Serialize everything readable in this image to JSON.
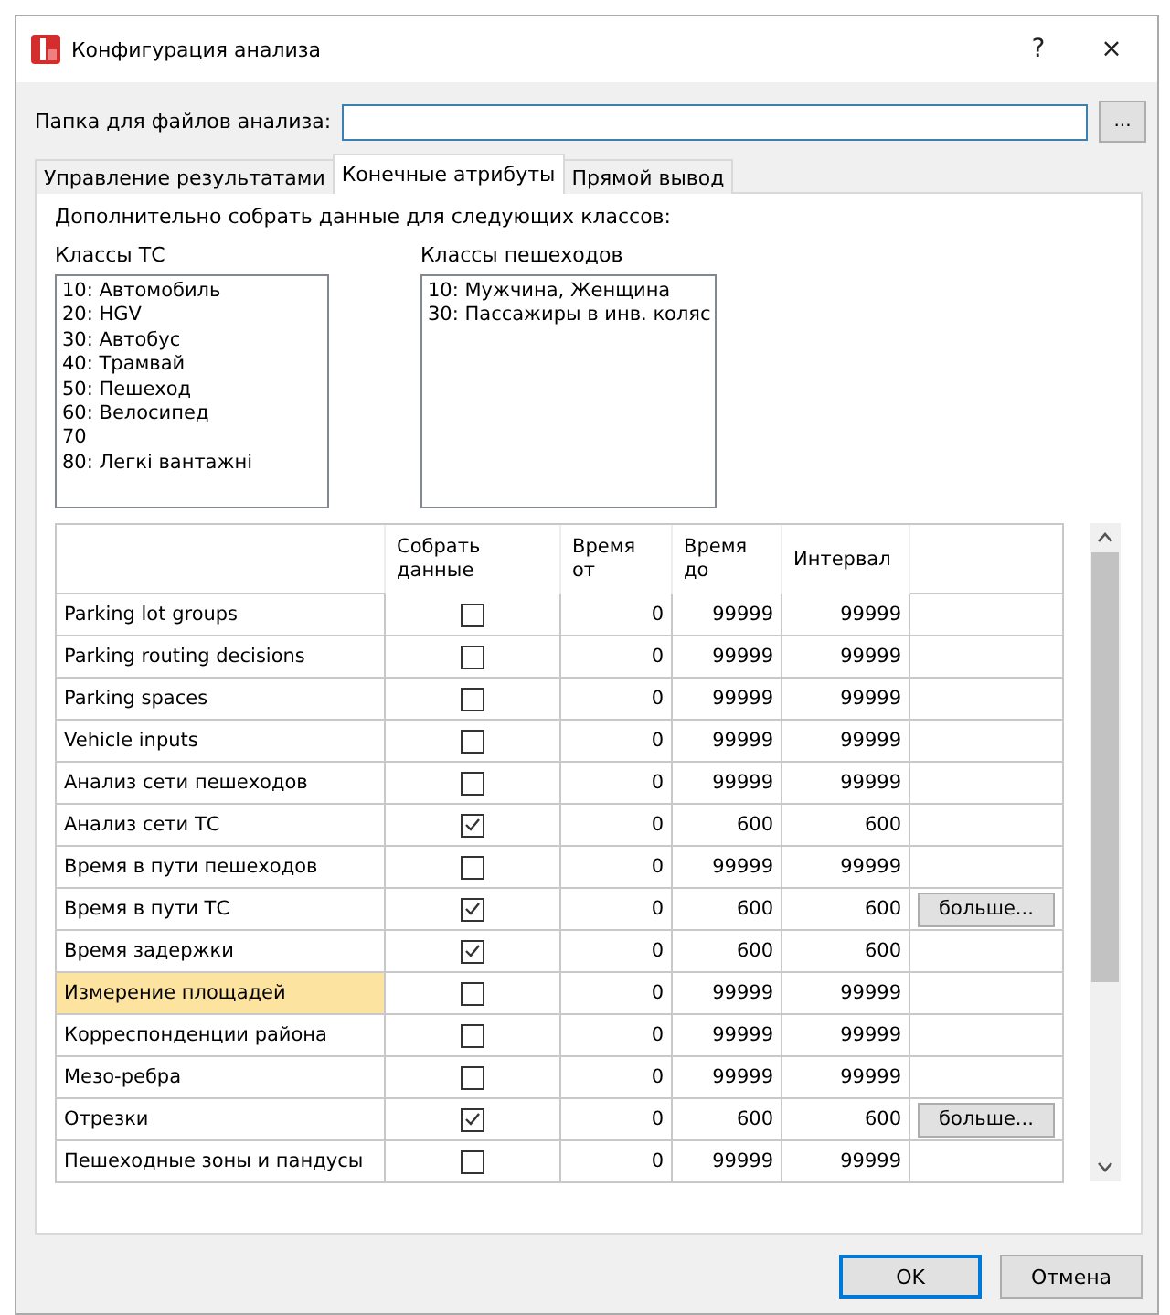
{
  "window": {
    "title": "Конфигурация анализа",
    "help": "?",
    "close": "×"
  },
  "folder": {
    "label": "Папка для файлов анализа:",
    "browse": "..."
  },
  "tabs": [
    {
      "label": "Управление результатами",
      "selected": false
    },
    {
      "label": "Конечные атрибуты",
      "selected": true
    },
    {
      "label": "Прямой вывод",
      "selected": false
    }
  ],
  "intro": "Дополнительно собрать данные для следующих классов:",
  "vehicle_classes": {
    "label": "Классы ТС",
    "items": [
      "10: Автомобиль",
      "20: HGV",
      "30: Автобус",
      "40: Трамвай",
      "50: Пешеход",
      "60: Велосипед",
      "70",
      "80: Легкі вантажні"
    ]
  },
  "pedestrian_classes": {
    "label": "Классы пешеходов",
    "items": [
      "10: Мужчина, Женщина",
      "30: Пассажиры в инв. коляс"
    ]
  },
  "table": {
    "columns": [
      "Собрать данные",
      "Время от",
      "Время до",
      "Интервал"
    ],
    "rows": [
      {
        "name": "Parking lot groups",
        "checked": false,
        "from": "0",
        "to": "99999",
        "interval": "99999",
        "selected": false
      },
      {
        "name": "Parking routing decisions",
        "checked": false,
        "from": "0",
        "to": "99999",
        "interval": "99999",
        "selected": false
      },
      {
        "name": "Parking spaces",
        "checked": false,
        "from": "0",
        "to": "99999",
        "interval": "99999",
        "selected": false
      },
      {
        "name": "Vehicle inputs",
        "checked": false,
        "from": "0",
        "to": "99999",
        "interval": "99999",
        "selected": false
      },
      {
        "name": "Анализ сети пешеходов",
        "checked": false,
        "from": "0",
        "to": "99999",
        "interval": "99999",
        "selected": false
      },
      {
        "name": "Анализ сети ТС",
        "checked": true,
        "from": "0",
        "to": "600",
        "interval": "600",
        "selected": false
      },
      {
        "name": "Время в пути пешеходов",
        "checked": false,
        "from": "0",
        "to": "99999",
        "interval": "99999",
        "selected": false
      },
      {
        "name": "Время в пути ТС",
        "checked": true,
        "from": "0",
        "to": "600",
        "interval": "600",
        "more": "больше...",
        "selected": false
      },
      {
        "name": "Время задержки",
        "checked": true,
        "from": "0",
        "to": "600",
        "interval": "600",
        "selected": false
      },
      {
        "name": "Измерение площадей",
        "checked": false,
        "from": "0",
        "to": "99999",
        "interval": "99999",
        "selected": true
      },
      {
        "name": "Корреспонденции района",
        "checked": false,
        "from": "0",
        "to": "99999",
        "interval": "99999",
        "selected": false
      },
      {
        "name": "Мезо-ребра",
        "checked": false,
        "from": "0",
        "to": "99999",
        "interval": "99999",
        "selected": false
      },
      {
        "name": "Отрезки",
        "checked": true,
        "from": "0",
        "to": "600",
        "interval": "600",
        "more": "больше...",
        "selected": false
      },
      {
        "name": "Пешеходные зоны и пандусы",
        "checked": false,
        "from": "0",
        "to": "99999",
        "interval": "99999",
        "selected": false
      }
    ]
  },
  "buttons": [
    {
      "label": "OK",
      "default": true
    },
    {
      "label": "Отмена",
      "default": false
    }
  ]
}
